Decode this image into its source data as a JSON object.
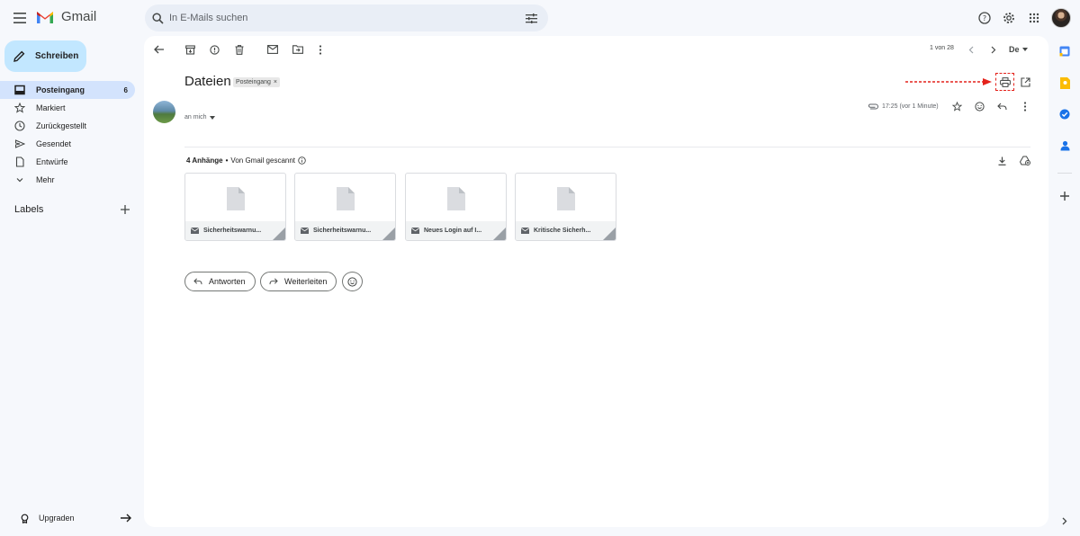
{
  "app": {
    "name": "Gmail"
  },
  "search": {
    "placeholder": "In E-Mails suchen"
  },
  "compose": {
    "label": "Schreiben"
  },
  "sidebar": {
    "items": [
      {
        "label": "Posteingang",
        "count": "6"
      },
      {
        "label": "Markiert"
      },
      {
        "label": "Zurückgestellt"
      },
      {
        "label": "Gesendet"
      },
      {
        "label": "Entwürfe"
      },
      {
        "label": "Mehr"
      }
    ],
    "labels_heading": "Labels",
    "upgrade": "Upgraden"
  },
  "toolbar": {
    "pager": "1 von 28",
    "language_code": "De"
  },
  "email": {
    "subject": "Dateien",
    "tag": "Posteingang",
    "recipient": "an mich",
    "time": "17:25 (vor 1 Minute)",
    "attachments_count": "4 Anhänge",
    "scanned": "Von Gmail gescannt",
    "attachments": [
      {
        "name": "Sicherheitswarnu..."
      },
      {
        "name": "Sicherheitswarnu..."
      },
      {
        "name": "Neues Login auf I..."
      },
      {
        "name": "Kritische Sicherh..."
      }
    ]
  },
  "actions": {
    "reply": "Antworten",
    "forward": "Weiterleiten"
  },
  "colors": {
    "accent": "#c2e7ff",
    "active_nav": "#d3e3fd",
    "highlight": "#e4221b"
  }
}
